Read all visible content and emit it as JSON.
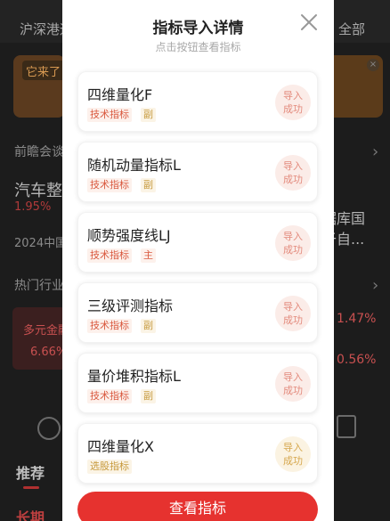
{
  "background": {
    "market_tab": "沪深港通",
    "all_tab": "全部",
    "banner_chip": "它来了",
    "section1": "前瞻会谈",
    "car_title": "汽车整车",
    "pct1": "1.95%",
    "year_text": "2024中国",
    "right_line1": "据库国",
    "right_line2": "于自...",
    "hot_section": "热门行业",
    "multi_label": "多元金融",
    "pct2": "6.66%",
    "pct3": "1.47%",
    "pct4": "0.56%",
    "recommend_tab": "推荐",
    "bottom_tab": "长期"
  },
  "modal": {
    "title": "指标导入详情",
    "subtitle": "点击按钮查看指标",
    "button_label": "查看指标",
    "items": [
      {
        "name": "四维量化F",
        "tag": "技术指标",
        "type": "副",
        "status_line1": "导入",
        "status_line2": "成功"
      },
      {
        "name": "随机动量指标L",
        "tag": "技术指标",
        "type": "副",
        "status_line1": "导入",
        "status_line2": "成功"
      },
      {
        "name": "顺势强度线LJ",
        "tag": "技术指标",
        "type": "主",
        "status_line1": "导入",
        "status_line2": "成功"
      },
      {
        "name": "三级评测指标",
        "tag": "技术指标",
        "type": "副",
        "status_line1": "导入",
        "status_line2": "成功"
      },
      {
        "name": "量价堆积指标L",
        "tag": "技术指标",
        "type": "副",
        "status_line1": "导入",
        "status_line2": "成功"
      },
      {
        "name": "四维量化X",
        "tag": "选股指标",
        "type": "",
        "status_line1": "导入",
        "status_line2": "成功"
      }
    ]
  },
  "colors": {
    "accent_red": "#e6322f",
    "tag_red": "#d9593f",
    "status_pink": "#fbece8",
    "status_gold": "#fbf3e2"
  }
}
